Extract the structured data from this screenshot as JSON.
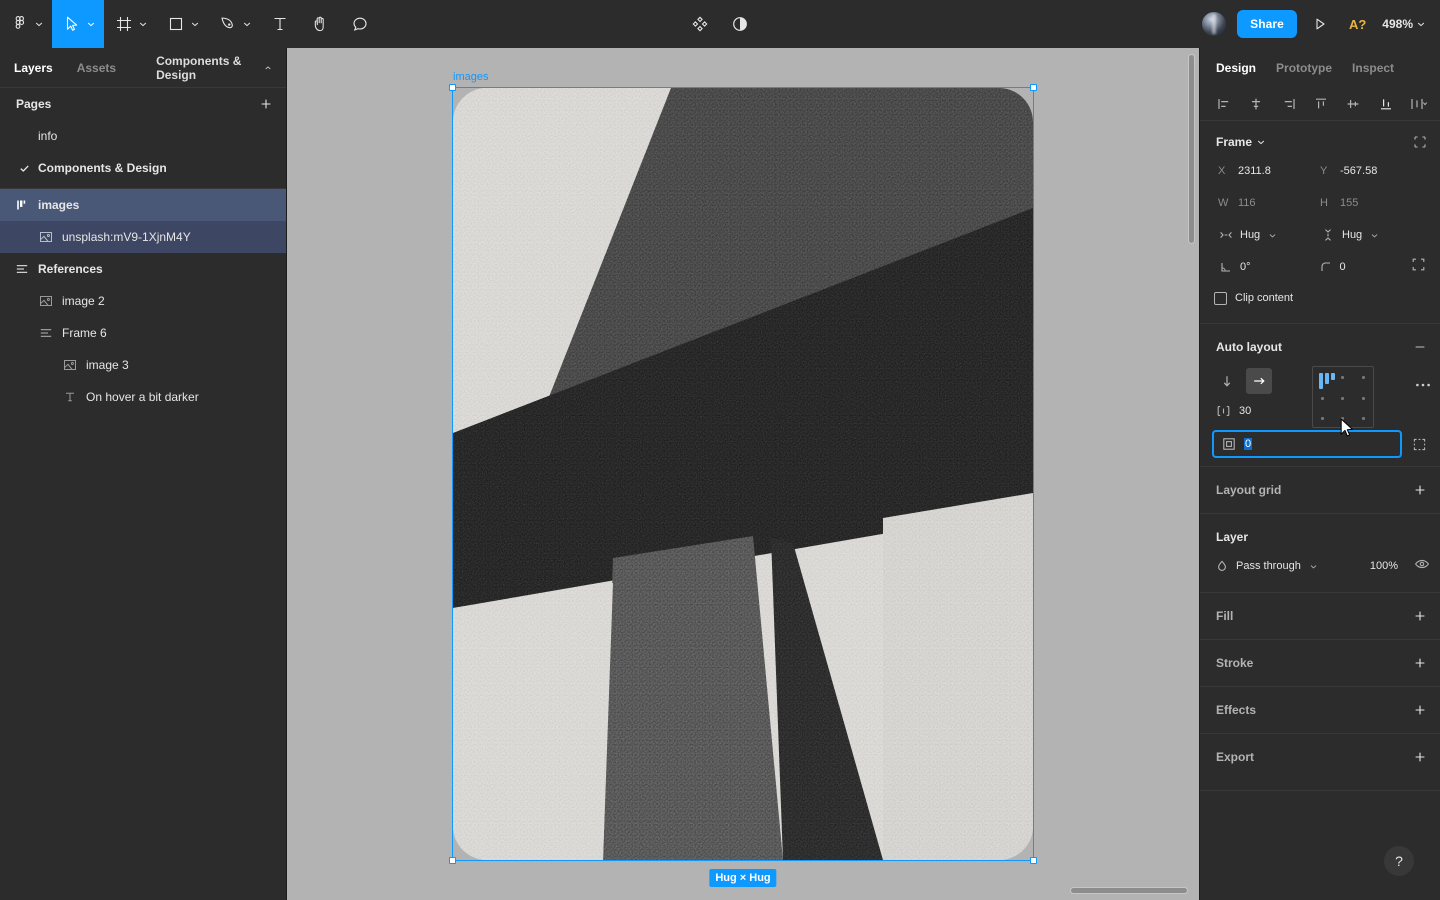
{
  "toolbar": {
    "tools": [
      {
        "name": "figma-logo-icon",
        "caret": true
      },
      {
        "name": "move-tool-icon",
        "caret": true,
        "active": true
      },
      {
        "name": "frame-tool-icon",
        "caret": true
      },
      {
        "name": "shape-tool-icon",
        "caret": true
      },
      {
        "name": "pen-tool-icon",
        "caret": true
      },
      {
        "name": "text-tool-icon",
        "caret": false
      },
      {
        "name": "hand-tool-icon",
        "caret": false
      },
      {
        "name": "comment-tool-icon",
        "caret": false
      }
    ],
    "center_actions": [
      {
        "name": "components-icon"
      },
      {
        "name": "dev-mode-icon"
      }
    ],
    "share_label": "Share",
    "ai_label": "A?",
    "zoom_label": "498%"
  },
  "left_panel": {
    "tabs": [
      {
        "label": "Layers",
        "active": true
      },
      {
        "label": "Assets",
        "active": false
      }
    ],
    "file_name": "Components & Design",
    "pages_title": "Pages",
    "pages": [
      {
        "label": "info",
        "selected": false
      },
      {
        "label": "Components & Design",
        "selected": true
      }
    ],
    "layers": [
      {
        "label": "images",
        "icon": "auto-layout-icon",
        "indent": 0,
        "state": "selected",
        "bold": true
      },
      {
        "label": "unsplash:mV9-1XjnM4Y",
        "icon": "image-icon",
        "indent": 1,
        "state": "child-selected",
        "bold": false
      },
      {
        "label": "References",
        "icon": "frame-list-icon",
        "indent": 0,
        "state": "none",
        "bold": true
      },
      {
        "label": "image 2",
        "icon": "image-icon",
        "indent": 1,
        "state": "none",
        "bold": false
      },
      {
        "label": "Frame 6",
        "icon": "frame-list-icon",
        "indent": 1,
        "state": "none",
        "bold": false
      },
      {
        "label": "image 3",
        "icon": "image-icon",
        "indent": 2,
        "state": "none",
        "bold": false
      },
      {
        "label": "On hover a bit darker",
        "icon": "text-layer-icon",
        "indent": 2,
        "state": "none",
        "bold": false
      }
    ]
  },
  "canvas": {
    "frame_label": "images",
    "size_badge": "Hug × Hug",
    "background_color": "#b3b3b3",
    "selection_color": "#0d99ff"
  },
  "right_panel": {
    "tabs": [
      {
        "label": "Design",
        "active": true
      },
      {
        "label": "Prototype",
        "active": false
      },
      {
        "label": "Inspect",
        "active": false
      }
    ],
    "align_buttons": [
      "align-left-icon",
      "align-horizontal-center-icon",
      "align-right-icon",
      "align-top-icon",
      "align-vertical-center-icon",
      "align-bottom-icon",
      "distribute-icon"
    ],
    "frame": {
      "title": "Frame",
      "x_label": "X",
      "x_value": "2311.8",
      "y_label": "Y",
      "y_value": "-567.58",
      "w_label": "W",
      "w_value": "116",
      "h_label": "H",
      "h_value": "155",
      "resize_w": "Hug",
      "resize_h": "Hug",
      "rotation": "0°",
      "corner_radius": "0",
      "clip_content_label": "Clip content",
      "clip_content_checked": false
    },
    "auto_layout": {
      "title": "Auto layout",
      "direction_vertical": "arrow-down-icon",
      "direction_horizontal": "arrow-right-icon",
      "direction_active": "horizontal",
      "gap_value": "30",
      "padding_value": "0",
      "padding_focused": true
    },
    "layout_grid": {
      "title": "Layout grid"
    },
    "layer": {
      "title": "Layer",
      "blend_mode": "Pass through",
      "opacity": "100%"
    },
    "sections": [
      {
        "title": "Fill"
      },
      {
        "title": "Stroke"
      },
      {
        "title": "Effects"
      },
      {
        "title": "Export"
      }
    ],
    "help_label": "?"
  }
}
